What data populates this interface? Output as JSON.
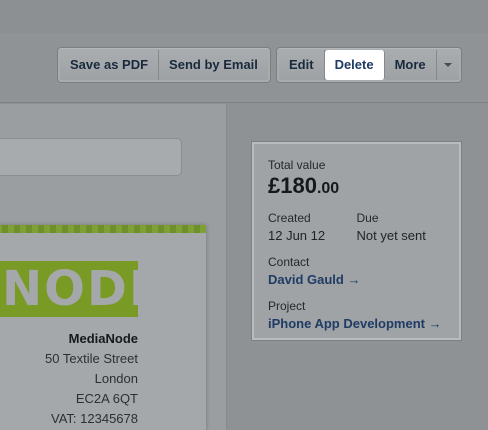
{
  "toolbar": {
    "save_pdf": "Save as PDF",
    "send_email": "Send by Email",
    "edit": "Edit",
    "delete": "Delete",
    "more": "More"
  },
  "document": {
    "logo_text": "NODE",
    "company": "MediaNode",
    "street": "50 Textile Street",
    "city": "London",
    "postcode": "EC2A 6QT",
    "vat": "VAT: 12345678"
  },
  "summary": {
    "total_label": "Total value",
    "total_main": "£180",
    "total_decimal": ".00",
    "created_label": "Created",
    "created_value": "12 Jun 12",
    "due_label": "Due",
    "due_value": "Not yet sent",
    "contact_label": "Contact",
    "contact_value": "David Gauld →",
    "project_label": "Project",
    "project_value": "iPhone App Development →"
  },
  "colors": {
    "overlay": "#8d9193",
    "active_button": "#ffffff",
    "link": "#1f3b66",
    "logo_green": "#7a9a26"
  }
}
